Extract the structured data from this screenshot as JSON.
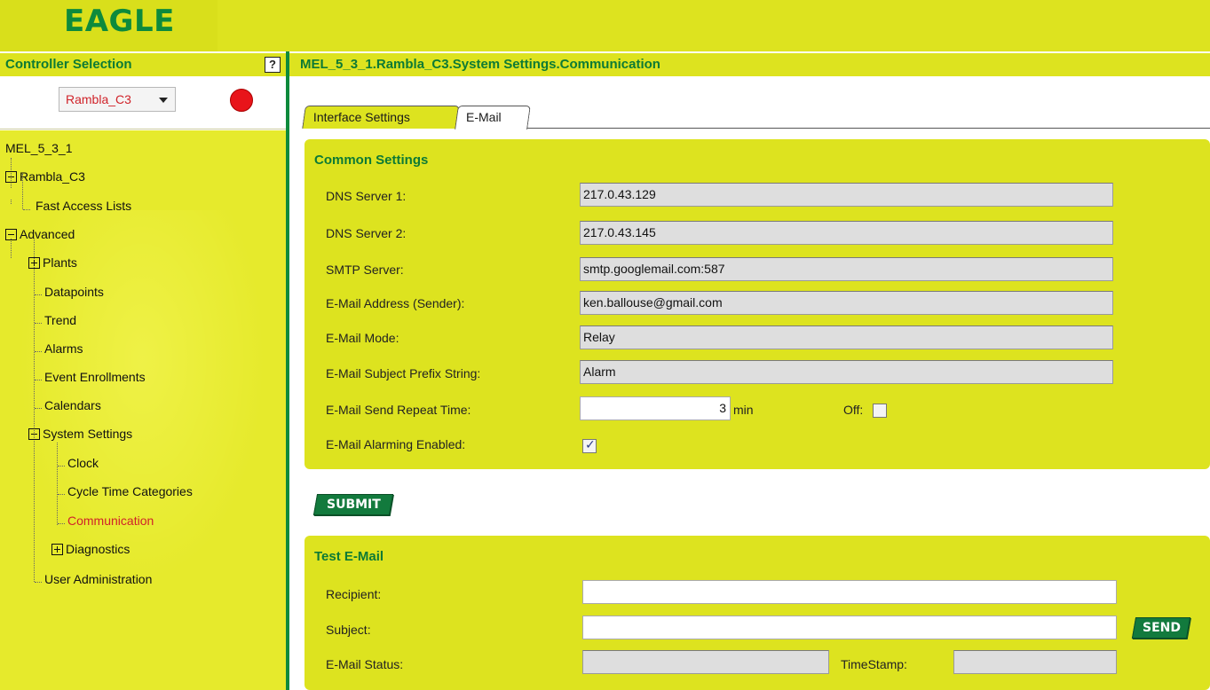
{
  "app": {
    "logo": "EAGLE"
  },
  "controller_selection": {
    "title": "Controller Selection",
    "help_label": "?",
    "selected": "Rambla_C3"
  },
  "tree": {
    "root": "MEL_5_3_1",
    "rambla": "Rambla_C3",
    "fast_access": "Fast Access Lists",
    "advanced": "Advanced",
    "plants": "Plants",
    "datapoints": "Datapoints",
    "trend": "Trend",
    "alarms": "Alarms",
    "event_enrollments": "Event Enrollments",
    "calendars": "Calendars",
    "system_settings": "System Settings",
    "clock": "Clock",
    "cycle_time": "Cycle Time Categories",
    "communication": "Communication",
    "diagnostics": "Diagnostics",
    "user_admin": "User Administration"
  },
  "header": {
    "breadcrumb": "MEL_5_3_1.Rambla_C3.System Settings.Communication"
  },
  "tabs": {
    "interface": "Interface Settings",
    "email": "E-Mail"
  },
  "common": {
    "title": "Common Settings",
    "dns1_label": "DNS Server 1:",
    "dns1_value": "217.0.43.129",
    "dns2_label": "DNS Server 2:",
    "dns2_value": "217.0.43.145",
    "smtp_label": "SMTP Server:",
    "smtp_value": "smtp.googlemail.com:587",
    "sender_label": "E-Mail Address (Sender):",
    "sender_value": "ken.ballouse@gmail.com",
    "mode_label": "E-Mail Mode:",
    "mode_value": "Relay",
    "prefix_label": "E-Mail Subject Prefix String:",
    "prefix_value": "Alarm",
    "repeat_label": "E-Mail Send Repeat Time:",
    "repeat_value": "3",
    "repeat_unit": "min",
    "off_label": "Off:",
    "off_checked": false,
    "alarming_label": "E-Mail Alarming Enabled:",
    "alarming_checked": true,
    "check_glyph": "✓"
  },
  "submit_label": "SUBMIT",
  "test": {
    "title": "Test E-Mail",
    "recipient_label": "Recipient:",
    "recipient_value": "",
    "subject_label": "Subject:",
    "subject_value": "",
    "send_label": "SEND",
    "status_label": "E-Mail Status:",
    "status_value": "",
    "timestamp_label": "TimeStamp:",
    "timestamp_value": ""
  },
  "colors": {
    "brand_yellow": "#dde31f",
    "brand_green": "#0d8a3c",
    "active_red": "#d0232a",
    "status_red": "#e8141a"
  }
}
